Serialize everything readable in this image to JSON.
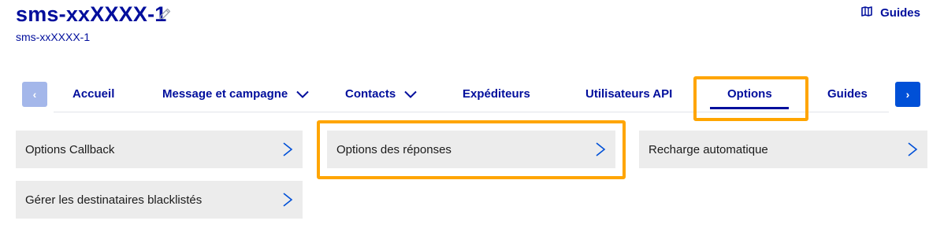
{
  "header": {
    "title": "sms-xxXXXX-1",
    "subtitle": "sms-xxXXXX-1",
    "guides_label": "Guides"
  },
  "nav": {
    "prev_glyph": "‹",
    "next_glyph": "›",
    "tabs": [
      {
        "label": "Accueil",
        "dropdown": false
      },
      {
        "label": "Message et campagne",
        "dropdown": true
      },
      {
        "label": "Contacts",
        "dropdown": true
      },
      {
        "label": "Expéditeurs",
        "dropdown": false
      },
      {
        "label": "Utilisateurs API",
        "dropdown": false
      },
      {
        "label": "Options",
        "dropdown": false,
        "active": true
      },
      {
        "label": "Guides",
        "dropdown": false
      }
    ]
  },
  "options": [
    {
      "label": "Options Callback"
    },
    {
      "label": "Options des réponses",
      "highlighted": true
    },
    {
      "label": "Recharge automatique"
    },
    {
      "label": "Gérer les destinataires blacklistés"
    }
  ],
  "colors": {
    "brand_blue": "#000e9c",
    "accent_blue": "#0050d7",
    "highlight_orange": "#ffa500",
    "tile_bg": "#ececec"
  }
}
